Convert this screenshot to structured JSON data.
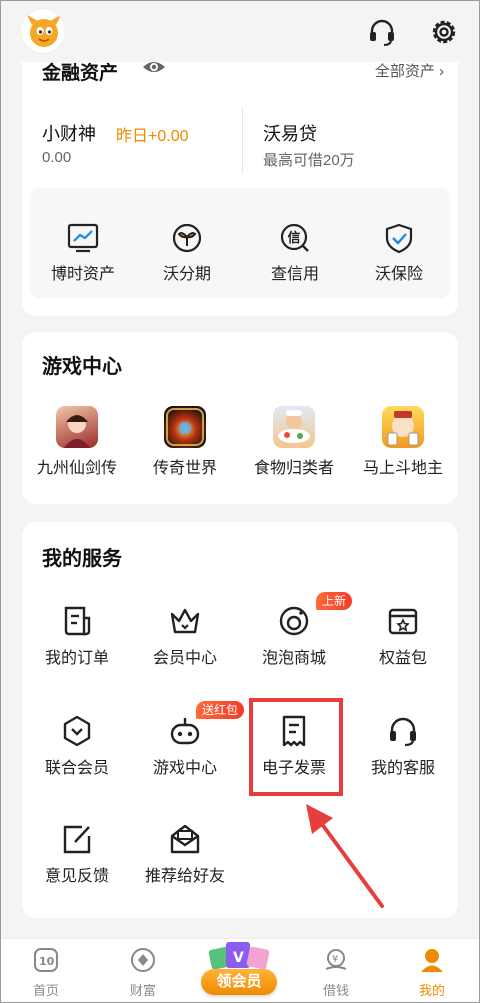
{
  "colors": {
    "accent": "#f08a00",
    "highlight": "#e83d3d",
    "badge": "#f33a2a"
  },
  "top_icons": [
    "headset-icon",
    "gear-icon"
  ],
  "assets": {
    "title": "金融资产",
    "all_link": "全部资产 ›",
    "items": [
      {
        "name": "小财神",
        "tag": "昨日+0.00",
        "value": "0.00"
      },
      {
        "name": "沃易贷",
        "value": "最高可借20万"
      }
    ],
    "quick": [
      {
        "label": "博时资产",
        "icon": "chart-icon"
      },
      {
        "label": "沃分期",
        "icon": "sprout-icon"
      },
      {
        "label": "查信用",
        "icon": "credit-search-icon"
      },
      {
        "label": "沃保险",
        "icon": "shield-check-icon"
      }
    ]
  },
  "games": {
    "title": "游戏中心",
    "items": [
      {
        "label": "九州仙剑传"
      },
      {
        "label": "传奇世界"
      },
      {
        "label": "食物归类者"
      },
      {
        "label": "马上斗地主"
      }
    ]
  },
  "services": {
    "title": "我的服务",
    "items": [
      {
        "label": "我的订单",
        "icon": "order-icon"
      },
      {
        "label": "会员中心",
        "icon": "crown-icon"
      },
      {
        "label": "泡泡商城",
        "icon": "bubble-icon",
        "badge": "上新"
      },
      {
        "label": "权益包",
        "icon": "wallet-icon"
      },
      {
        "label": "联合会员",
        "icon": "hexagon-chevron-icon"
      },
      {
        "label": "游戏中心",
        "icon": "gamepad-icon",
        "badge": "送红包"
      },
      {
        "label": "电子发票",
        "icon": "invoice-icon"
      },
      {
        "label": "我的客服",
        "icon": "headset-icon"
      },
      {
        "label": "意见反馈",
        "icon": "edit-icon"
      },
      {
        "label": "推荐给好友",
        "icon": "share-mail-icon"
      }
    ]
  },
  "nav": {
    "items": [
      {
        "label": "首页",
        "icon": "home-icon"
      },
      {
        "label": "财富",
        "icon": "wealth-icon"
      },
      {
        "label": "领会员",
        "icon": "vip-icon"
      },
      {
        "label": "借钱",
        "icon": "loan-icon"
      },
      {
        "label": "我的",
        "icon": "profile-icon",
        "active": true
      }
    ]
  }
}
